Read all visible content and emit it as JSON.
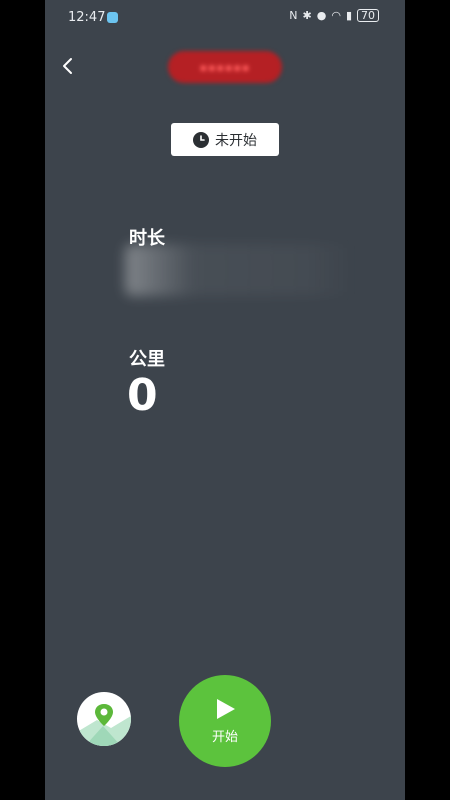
{
  "status_bar": {
    "time": "12:47",
    "battery": "70",
    "icons": [
      "nfc-icon",
      "bluetooth-icon",
      "location-icon",
      "wifi-icon",
      "battery-saver-icon",
      "battery-icon"
    ]
  },
  "header": {
    "back_icon": "chevron-left-icon",
    "gps_badge": {
      "color": "#b52024"
    }
  },
  "workout_status": {
    "icon": "clock-icon",
    "label": "未开始"
  },
  "metrics": {
    "duration_label": "时长",
    "distance_label": "公里",
    "distance_value": "0"
  },
  "controls": {
    "map_icon": "map-location-icon",
    "start_label": "开始",
    "start_color": "#5cc33d"
  },
  "colors": {
    "background": "#3d444c",
    "accent_green": "#5cc33d",
    "chip_bg": "#ffffff"
  }
}
